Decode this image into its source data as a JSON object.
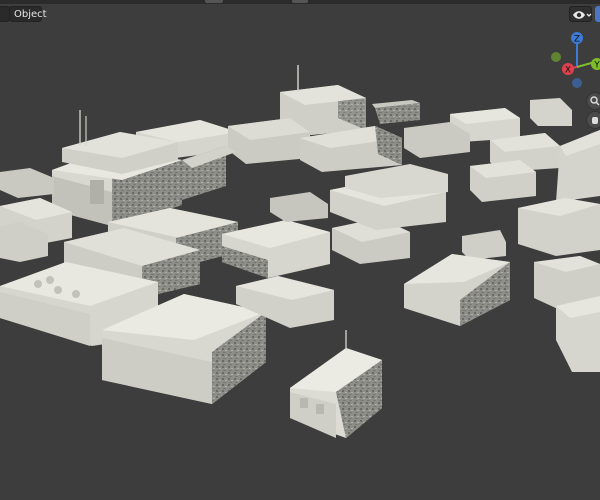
{
  "header": {
    "mode_label": "",
    "object_menu_label": "Object"
  },
  "gizmo": {
    "z_label": "Z",
    "x_label": "X",
    "y_label": "Y"
  },
  "colors": {
    "viewport_bg": "#3d3d3d",
    "axis_z": "#3d7bd6",
    "axis_x": "#e0424d",
    "axis_y": "#7ebd2a",
    "building_light": "#dcdcd4",
    "building_mid": "#c8c8c0",
    "building_dark": "#8d8d88"
  },
  "icons": {
    "visibility": "eye-icon",
    "zoom": "zoom-icon",
    "pan": "hand-icon",
    "camera": "camera-icon",
    "ortho": "grid-icon"
  }
}
